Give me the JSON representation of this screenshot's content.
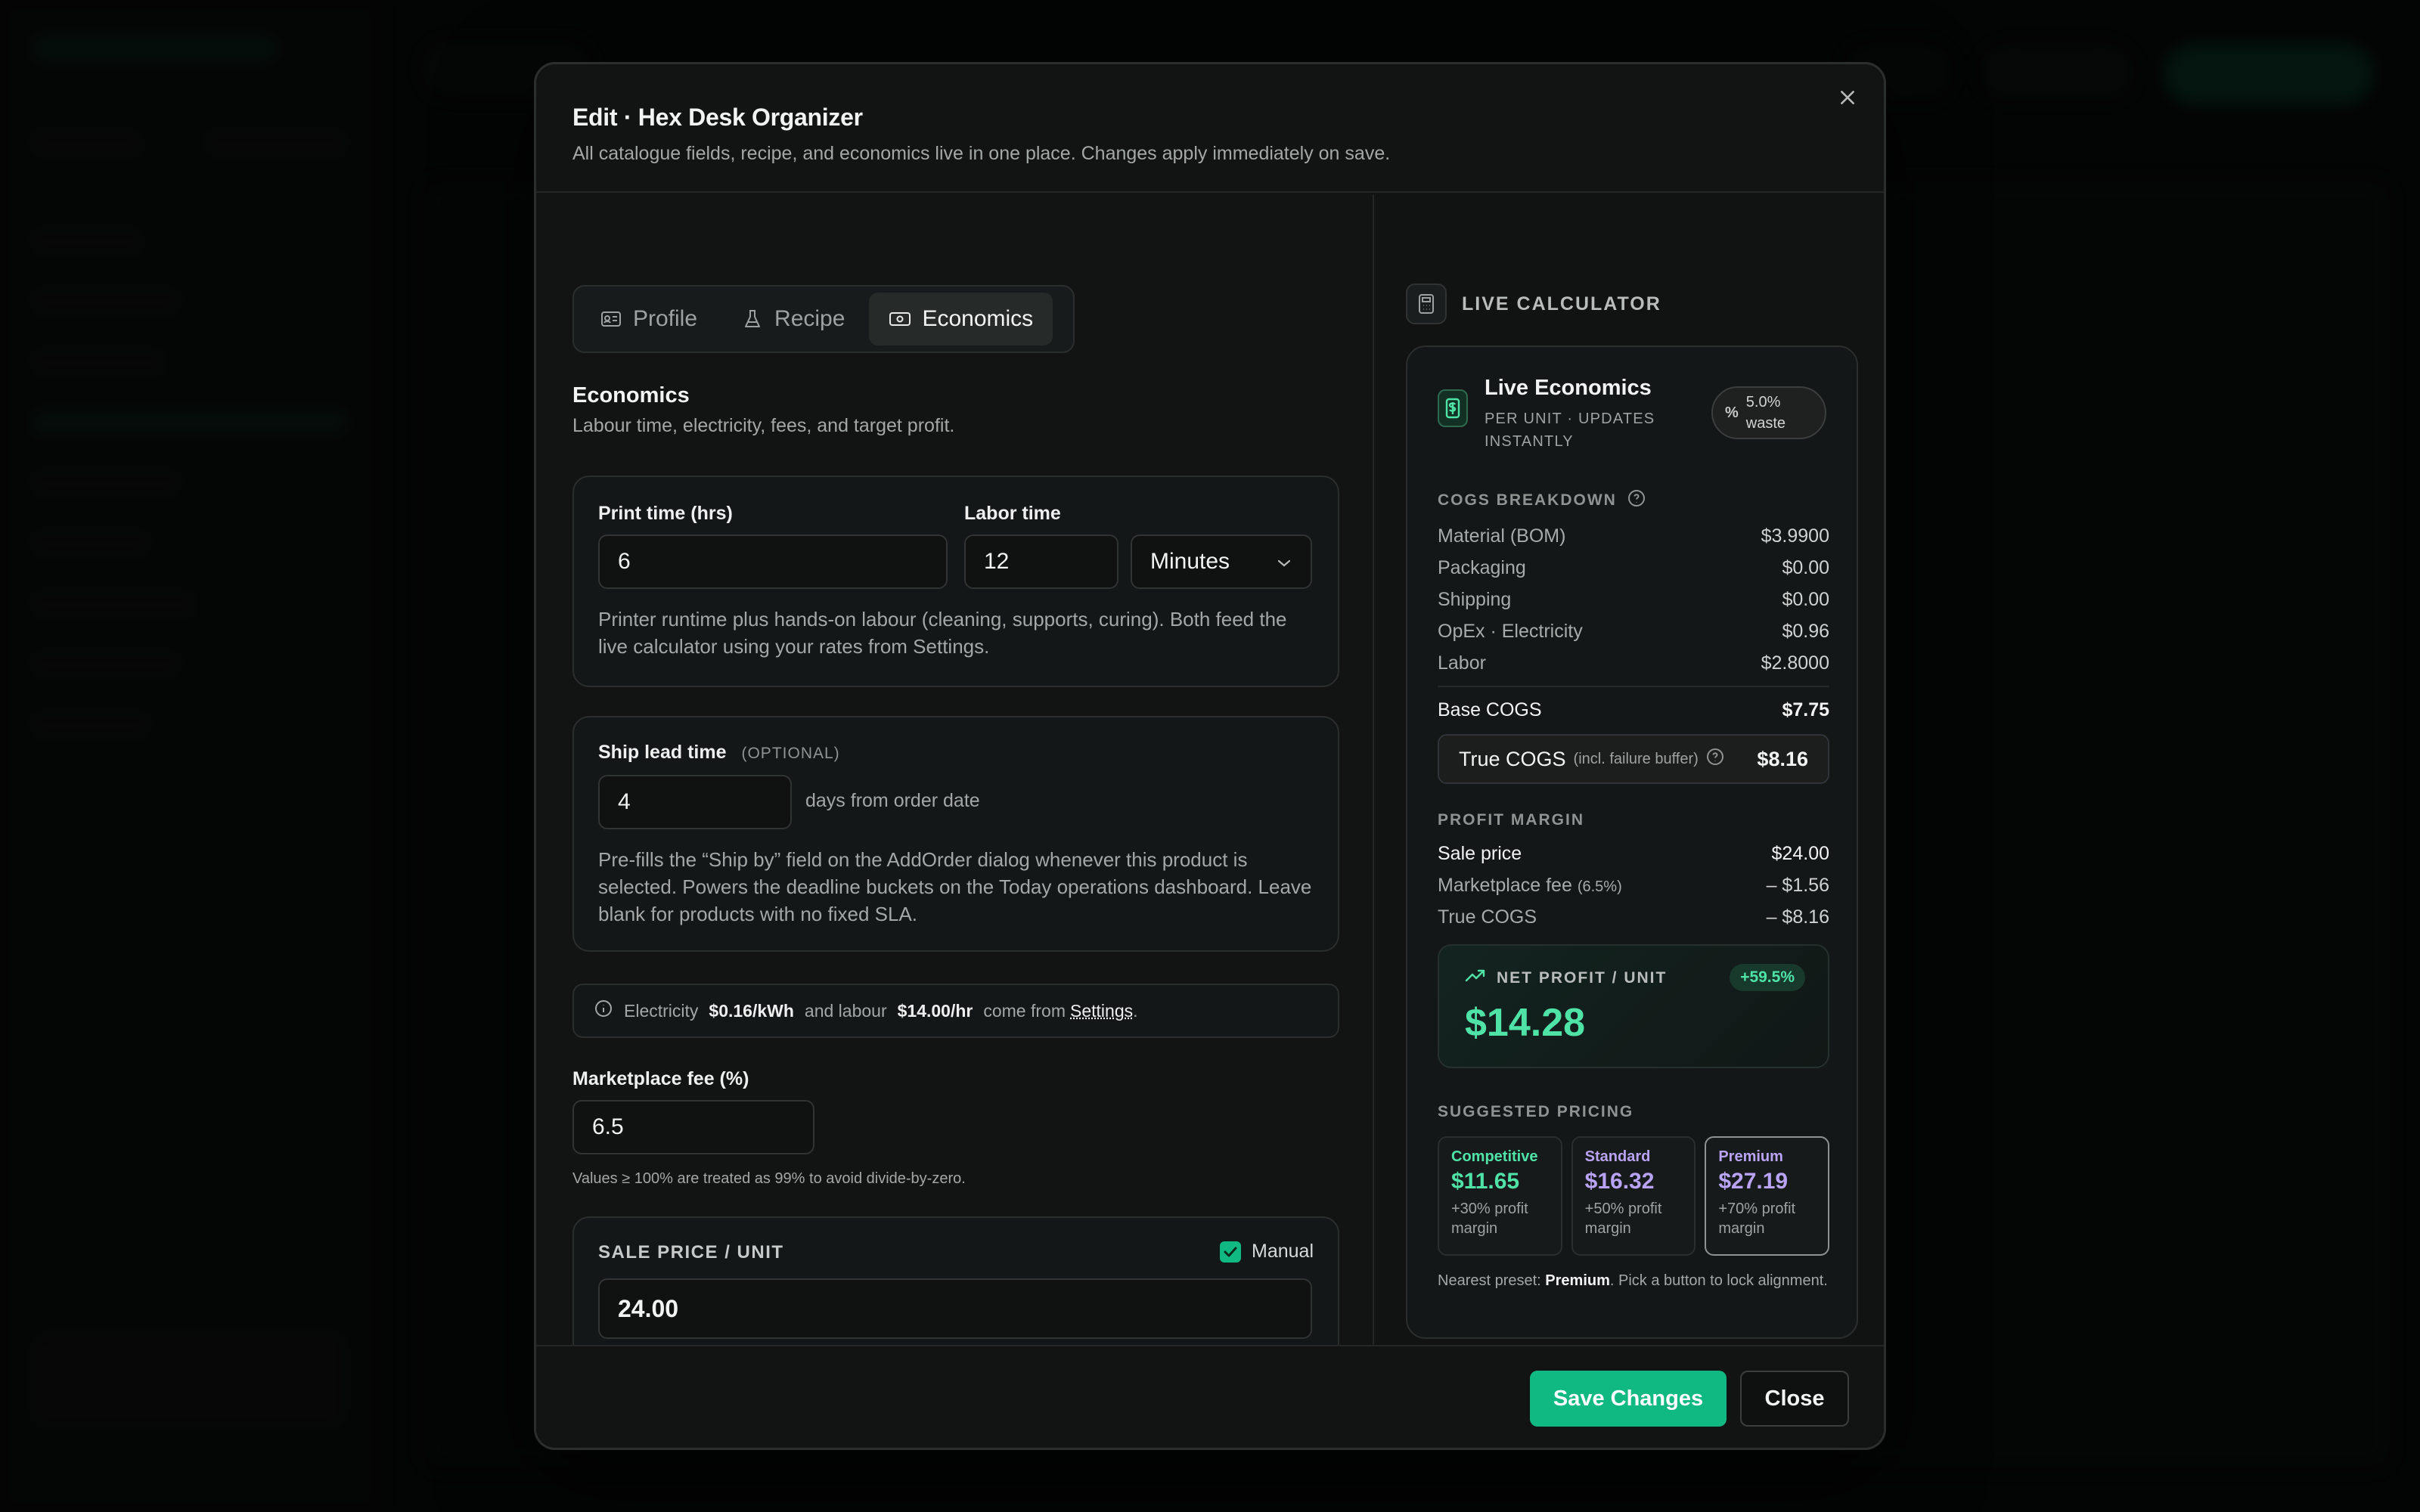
{
  "colors": {
    "accent": "#10b981",
    "profit_green": "#4fe3a8",
    "premium_purple": "#b9a3f5"
  },
  "modal": {
    "title": "Edit · Hex Desk Organizer",
    "subtitle": "All catalogue fields, recipe, and economics live in one place. Changes apply immediately on save.",
    "close_icon": "close-icon"
  },
  "tabs": [
    {
      "label": "Profile",
      "icon": "id-card-icon",
      "active": false
    },
    {
      "label": "Recipe",
      "icon": "flask-icon",
      "active": false
    },
    {
      "label": "Economics",
      "icon": "money-icon",
      "active": true
    }
  ],
  "economics": {
    "title": "Economics",
    "subtitle": "Labour time, electricity, fees, and target profit.",
    "print_time_label": "Print time (hrs)",
    "print_time_value": "6",
    "labor_time_label": "Labor time",
    "labor_time_value": "12",
    "labor_unit": "Minutes",
    "time_help": "Printer runtime plus hands-on labour (cleaning, supports, curing). Both feed the live calculator using your rates from Settings.",
    "ship_lead_label": "Ship lead time",
    "ship_lead_optional": "(OPTIONAL)",
    "ship_lead_value": "4",
    "ship_lead_suffix": "days from order date",
    "ship_help": "Pre-fills the “Ship by” field on the AddOrder dialog whenever this product is selected. Powers the deadline buckets on the Today operations dashboard. Leave blank for products with no fixed SLA.",
    "info": {
      "electricity_prefix": "Electricity",
      "electricity_value": "$0.16/kWh",
      "labour_prefix": "and labour",
      "labour_value": "$14.00/hr",
      "settings_prefix": "come from",
      "settings_link": "Settings",
      "period": "."
    },
    "marketplace_fee_label": "Marketplace fee (%)",
    "marketplace_fee_value": "6.5",
    "marketplace_fee_help": "Values ≥ 100% are treated as 99% to avoid divide-by-zero.",
    "sale_price_label": "SALE PRICE / UNIT",
    "manual_label": "Manual",
    "manual_checked": true,
    "sale_price_value": "24.00"
  },
  "calculator": {
    "header": "LIVE CALCULATOR",
    "title": "Live Economics",
    "subtitle_line1": "PER UNIT · UPDATES",
    "subtitle_line2": "INSTANTLY",
    "waste_line1": "5.0%",
    "waste_line2": "waste",
    "cogs_caption": "COGS BREAKDOWN",
    "cogs": [
      {
        "label": "Material (BOM)",
        "value": "$3.9900"
      },
      {
        "label": "Packaging",
        "value": "$0.00"
      },
      {
        "label": "Shipping",
        "value": "$0.00"
      },
      {
        "label": "OpEx · Electricity",
        "value": "$0.96"
      },
      {
        "label": "Labor",
        "value": "$2.8000"
      }
    ],
    "base_cogs_label": "Base COGS",
    "base_cogs_value": "$7.75",
    "true_cogs_label": "True COGS",
    "true_cogs_note": "(incl. failure buffer)",
    "true_cogs_value": "$8.16",
    "profit_caption": "PROFIT MARGIN",
    "sale_price_label": "Sale price",
    "sale_price_value": "$24.00",
    "fee_label": "Marketplace fee",
    "fee_pct": "(6.5%)",
    "fee_value": "– $1.56",
    "true_cogs_row_label": "True COGS",
    "true_cogs_row_value": "– $8.16",
    "net_profit_caption": "NET PROFIT / UNIT",
    "net_profit_badge": "+59.5%",
    "net_profit_value": "$14.28",
    "suggested_caption": "SUGGESTED PRICING",
    "suggested": [
      {
        "name": "Competitive",
        "value": "$11.65",
        "desc": "+30% profit margin",
        "color": "#4fe3a8",
        "selected": false
      },
      {
        "name": "Standard",
        "value": "$16.32",
        "desc": "+50% profit margin",
        "color": "#b9a3f5",
        "selected": false
      },
      {
        "name": "Premium",
        "value": "$27.19",
        "desc": "+70% profit margin",
        "color": "#b9a3f5",
        "selected": true
      }
    ],
    "nearest_prefix": "Nearest preset:",
    "nearest_value": "Premium",
    "nearest_suffix": ". Pick a button to lock alignment."
  },
  "footer": {
    "save_label": "Save Changes",
    "close_label": "Close"
  }
}
